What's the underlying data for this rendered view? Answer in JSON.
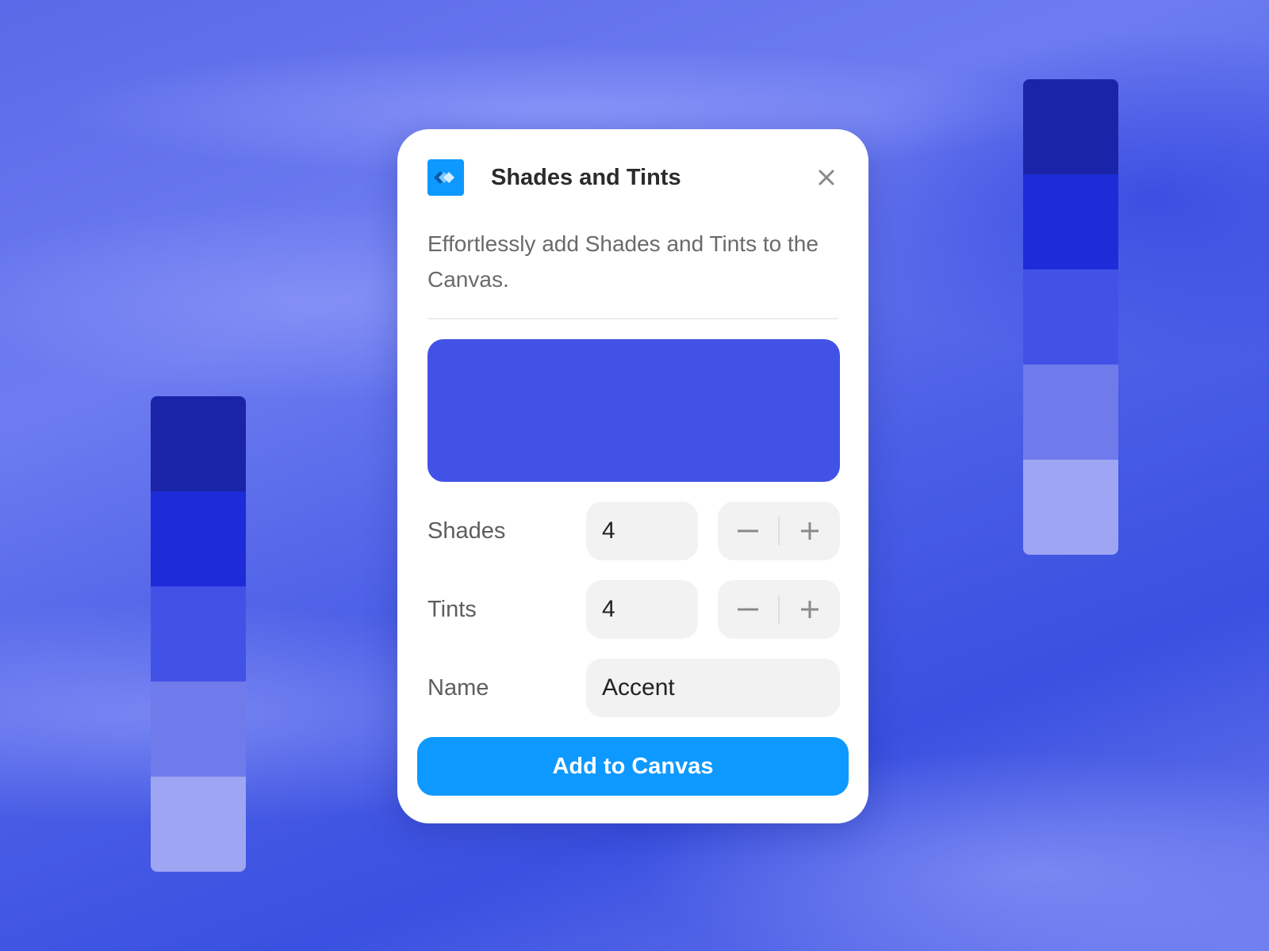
{
  "dialog": {
    "title": "Shades and Tints",
    "description": "Effortlessly add Shades and Tints to the Canvas.",
    "preview_color": "#4352e6",
    "shades": {
      "label": "Shades",
      "value": "4"
    },
    "tints": {
      "label": "Tints",
      "value": "4"
    },
    "name": {
      "label": "Name",
      "value": "Accent"
    },
    "add_button": "Add to Canvas",
    "icons": {
      "app": "app-logo-icon",
      "close": "close-icon",
      "minus": "minus-icon",
      "plus": "plus-icon"
    }
  },
  "palettes": {
    "left": [
      "#1a24a8",
      "#1d2cd8",
      "#4352e6",
      "#6f7aeb",
      "#9ea5f2"
    ],
    "right": [
      "#1a24a8",
      "#1d2cd8",
      "#4352e6",
      "#6f7aeb",
      "#9ea5f2"
    ]
  },
  "colors": {
    "accent": "#0d99ff",
    "brand_blue": "#4352e6"
  }
}
